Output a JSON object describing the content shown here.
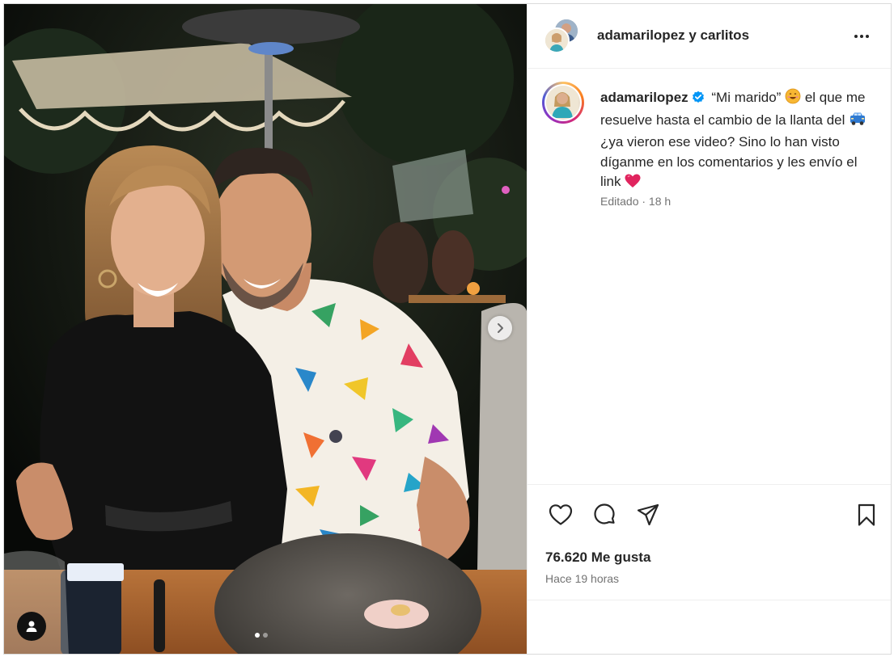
{
  "post": {
    "header": {
      "title": "adamarilopez y carlitos",
      "more_icon": "more-horizontal-icon"
    },
    "caption": {
      "username": "adamarilopez",
      "verified_icon": "verified-badge-icon",
      "text_part1": "“Mi marido”",
      "emoji1": "smiling-face-emoji",
      "text_part2": "el que me resuelve hasta el cambio de la llanta del",
      "emoji2": "car-emoji",
      "text_part3": "¿ya vieron ese video? Sino lo han visto díganme en los comentarios y les envío el link",
      "emoji3": "heart-emoji",
      "meta": "Editado · 18 h"
    },
    "actions": {
      "like_icon": "heart-icon",
      "comment_icon": "comment-icon",
      "share_icon": "send-icon",
      "save_icon": "bookmark-icon"
    },
    "likes": "76.620 Me gusta",
    "time": "Hace 19 horas",
    "carousel": {
      "current": 1,
      "total": 2
    }
  },
  "colors": {
    "verified": "#0095f6",
    "text": "#262626",
    "muted": "#737373",
    "divider": "#efefef"
  }
}
